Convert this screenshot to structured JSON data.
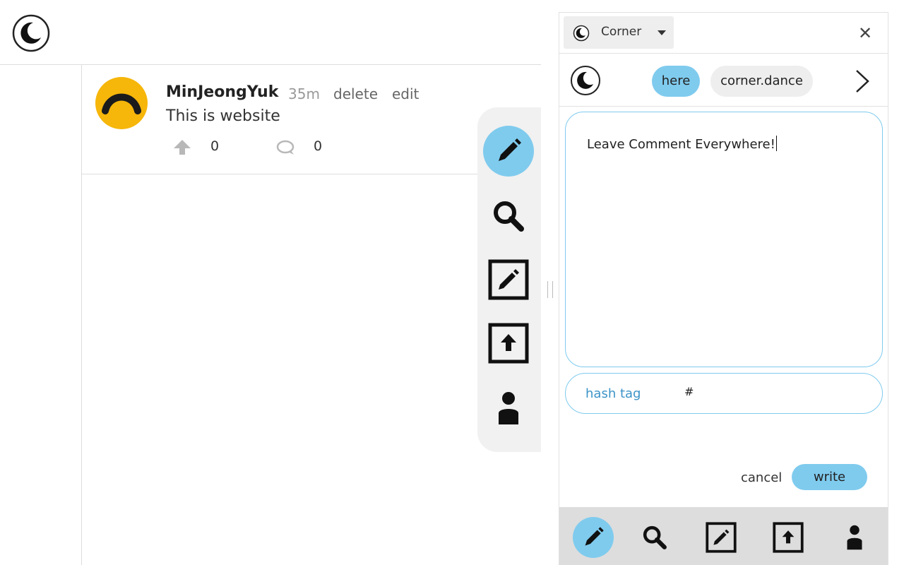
{
  "app": {
    "name": "Corner"
  },
  "post": {
    "username": "MinJeongYuk",
    "time": "35m",
    "delete_label": "delete",
    "edit_label": "edit",
    "text": "This is website",
    "upvotes": "0",
    "comments": "0"
  },
  "nav": {
    "chips": [
      "here",
      "corner.dance"
    ]
  },
  "composer": {
    "text": "Leave Comment Everywhere!",
    "hashtag_label": "hash tag",
    "hashtag_value": "#",
    "cancel_label": "cancel",
    "write_label": "write"
  },
  "icons": {
    "logo": "moon-icon",
    "write": "pencil-icon",
    "search": "search-icon",
    "edit": "edit-square-icon",
    "upload": "upload-square-icon",
    "profile": "person-icon",
    "close": "close-icon",
    "next": "chevron-right-icon",
    "upvote": "arrow-up-icon",
    "comment": "comment-icon"
  },
  "colors": {
    "accent": "#7fcbee",
    "avatar": "#f6b60a",
    "hashtag_label": "#3c94c8"
  }
}
